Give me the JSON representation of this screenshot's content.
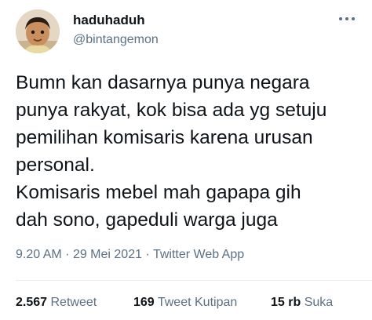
{
  "author": {
    "display_name": "haduhaduh",
    "handle": "@bintangemon",
    "avatar_icon": "avatar-photo"
  },
  "tweet": {
    "lines": [
      "Bumn kan dasarnya punya negara",
      "punya rakyat, kok bisa ada yg setuju",
      "pemilihan komisaris karena urusan",
      "personal.",
      "Komisaris mebel mah gapapa gih",
      "dah sono, gapeduli warga juga"
    ]
  },
  "meta": {
    "time": "9.20 AM",
    "separator": "·",
    "date": "29 Mei 2021",
    "source": "Twitter Web App"
  },
  "stats": {
    "retweets": {
      "count": "2.567",
      "label": "Retweet"
    },
    "quotes": {
      "count": "169",
      "label": "Tweet Kutipan"
    },
    "likes": {
      "count": "15 rb",
      "label": "Suka"
    }
  },
  "colors": {
    "text_primary": "#0f1419",
    "text_secondary": "#5b7083",
    "divider": "#e6ecf0"
  }
}
